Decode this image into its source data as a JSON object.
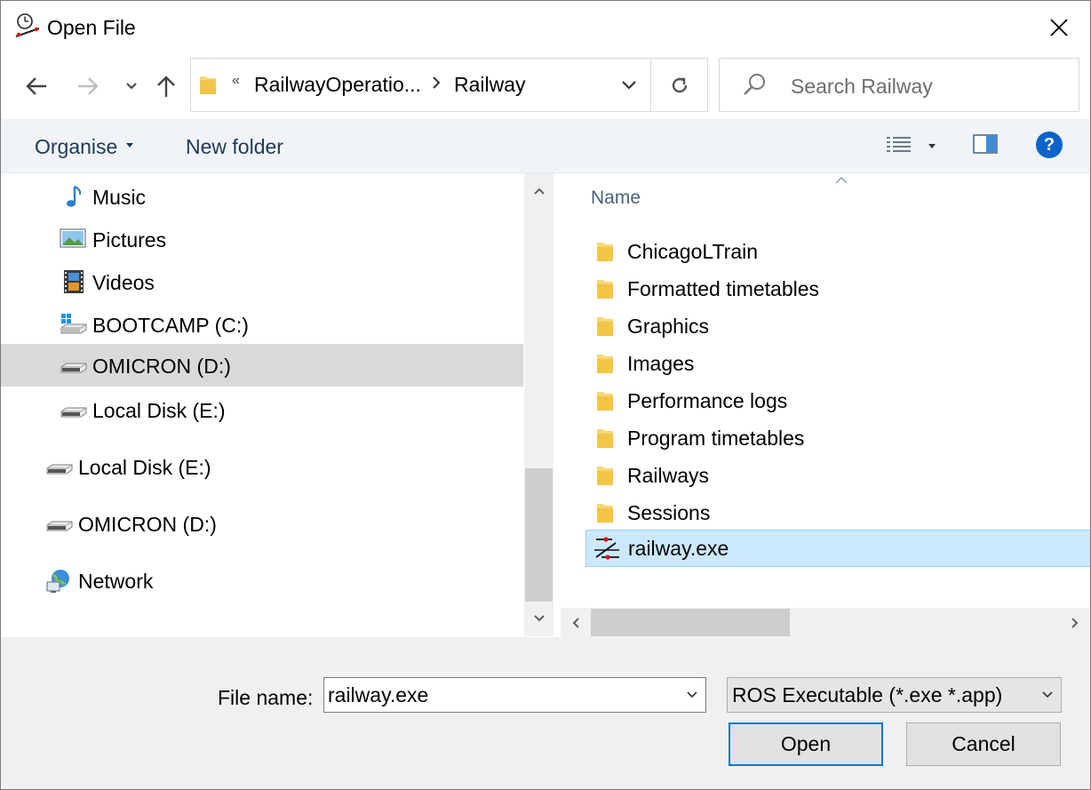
{
  "window": {
    "title": "Open File",
    "icon": "ros-clock-icon",
    "close_icon": "close-icon"
  },
  "navigation": {
    "back_icon": "arrow-left-icon",
    "forward_icon": "arrow-right-icon",
    "recent_icon": "chevron-down-icon",
    "up_icon": "arrow-up-icon"
  },
  "address_bar": {
    "overflow_glyph": "«",
    "segments": [
      "RailwayOperatio...",
      "Railway"
    ],
    "refresh_icon": "refresh-icon"
  },
  "search": {
    "placeholder": "Search Railway",
    "icon": "search-icon"
  },
  "toolbar": {
    "organise_label": "Organise",
    "new_folder_label": "New folder",
    "views_icon": "details-view-icon",
    "preview_icon": "preview-pane-icon",
    "help_label": "?"
  },
  "nav_pane": {
    "items": [
      {
        "label": "Music",
        "icon": "music-icon",
        "selected": false
      },
      {
        "label": "Pictures",
        "icon": "pictures-icon",
        "selected": false
      },
      {
        "label": "Videos",
        "icon": "videos-icon",
        "selected": false
      },
      {
        "label": "BOOTCAMP (C:)",
        "icon": "windows-drive-icon",
        "selected": false
      },
      {
        "label": "OMICRON (D:)",
        "icon": "drive-icon",
        "selected": true
      },
      {
        "label": "Local Disk (E:)",
        "icon": "drive-icon",
        "selected": false
      },
      {
        "label": "Local Disk (E:)",
        "icon": "drive-icon",
        "selected": false
      },
      {
        "label": "OMICRON (D:)",
        "icon": "drive-icon",
        "selected": false
      },
      {
        "label": "Network",
        "icon": "network-icon",
        "selected": false
      }
    ]
  },
  "file_list": {
    "column_header": "Name",
    "files": [
      {
        "name": "ChicagoLTrain",
        "type": "folder",
        "selected": false
      },
      {
        "name": "Formatted timetables",
        "type": "folder",
        "selected": false
      },
      {
        "name": "Graphics",
        "type": "folder",
        "selected": false
      },
      {
        "name": "Images",
        "type": "folder",
        "selected": false
      },
      {
        "name": "Performance logs",
        "type": "folder",
        "selected": false
      },
      {
        "name": "Program timetables",
        "type": "folder",
        "selected": false
      },
      {
        "name": "Railways",
        "type": "folder",
        "selected": false
      },
      {
        "name": "Sessions",
        "type": "folder",
        "selected": false
      },
      {
        "name": "railway.exe",
        "type": "executable",
        "selected": true
      }
    ]
  },
  "footer": {
    "file_name_label": "File name:",
    "file_name_value": "railway.exe",
    "file_type_value": "ROS Executable (*.exe *.app)",
    "open_label": "Open",
    "cancel_label": "Cancel"
  },
  "colors": {
    "selection": "#cce8ff",
    "nav_selection": "#d9d9d9",
    "accent": "#0078d7",
    "toolbar_bg": "#f0f4f9",
    "folder": "#f8d775"
  }
}
